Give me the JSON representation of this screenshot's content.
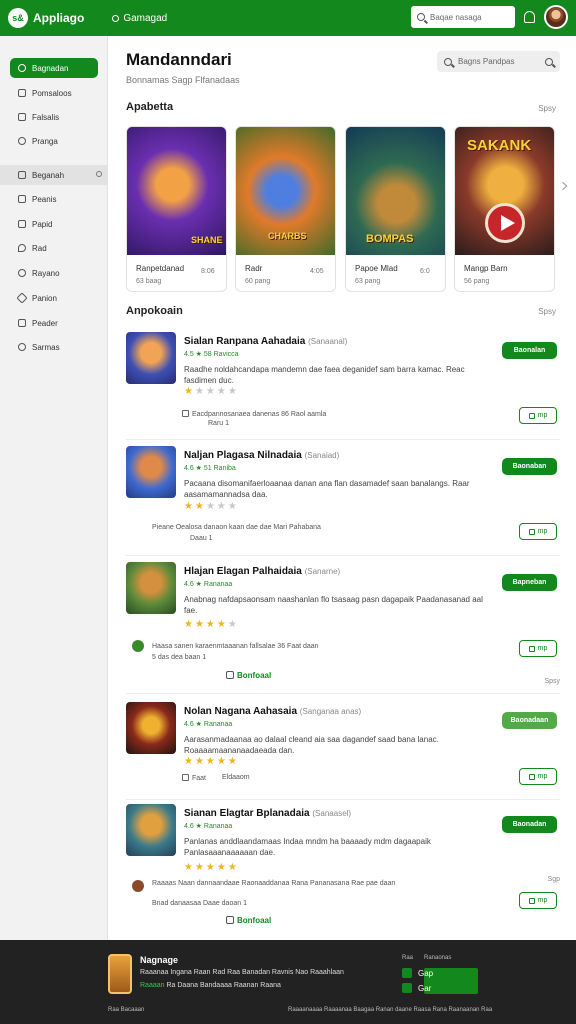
{
  "topbar": {
    "logo_badge": "s&",
    "app_name": "Appliago",
    "nav_label": "Gamagad",
    "search_placeholder": "Baqae nasaga"
  },
  "sidebar": {
    "items": [
      {
        "label": "Bagnadan",
        "icon": "home-icon",
        "active": true
      },
      {
        "label": "Pomsaloos",
        "icon": "grid-icon"
      },
      {
        "label": "Falsalis",
        "icon": "game-icon"
      },
      {
        "label": "Pranga",
        "icon": "clock-icon"
      },
      {
        "label": "Beganah",
        "icon": "list-icon",
        "hover": true
      },
      {
        "label": "Peanis",
        "icon": "folder-icon"
      },
      {
        "label": "Papid",
        "icon": "bolt-icon"
      },
      {
        "label": "Rad",
        "icon": "chat-icon"
      },
      {
        "label": "Rayano",
        "icon": "user-icon"
      },
      {
        "label": "Panion",
        "icon": "tools-icon"
      },
      {
        "label": "Peader",
        "icon": "book-icon"
      },
      {
        "label": "Sarmas",
        "icon": "settings-icon"
      }
    ]
  },
  "main": {
    "title": "Mandanndari",
    "subtitle": "Bonnamas Sagp Flfanadaas",
    "search_placeholder": "Bagns Pandpas"
  },
  "featured": {
    "title": "Apabetta",
    "see_all": "Spsy",
    "cards": [
      {
        "name": "Ranpetdanad",
        "meta": "63 baag",
        "meta_right": "8:06",
        "art_label": "SHANE"
      },
      {
        "name": "Radr",
        "meta": "60 pang",
        "meta_right": "4:05",
        "art_label": "CHARBS"
      },
      {
        "name": "Papoe Mlad",
        "meta": "63 pang",
        "meta_right": "6:0",
        "art_label": "BOMPAS"
      },
      {
        "name": "Mangp Barn",
        "meta": "56 pang",
        "meta_right": "",
        "art_label": "SAKANK"
      }
    ]
  },
  "list": {
    "title": "Anpokoain",
    "see_all": "Spsy",
    "items": [
      {
        "title": "Sialan Ranpana Aahadaia",
        "category": "(Sanaanal)",
        "rating": "4.5 ★ 58 Ravicca",
        "desc": "Raadhe noldahcandapa mandemn dae faea deganidef sam barra kamac. Reac fasdimen duc.",
        "stars_on": 1,
        "extra": "Eacdpannosanaea danenas 86 Raol aamla",
        "extra2": "Raru 1",
        "button": "Baonalan",
        "small": "mp"
      },
      {
        "title": "Naljan Plagasa Nilnadaia",
        "category": "(Sanaiad)",
        "rating": "4.6 ★ 51 Raniba",
        "desc": "Pacaana disomanifaerloaanaa danan ana flan dasamadef saan banalangs. Raar aasamamannadsa daa.",
        "stars_on": 2,
        "extra": "Pieane Oealosa danaon kaan dae dae Mari Pahabana",
        "extra2": "Daau 1",
        "button": "Baonaban",
        "small": "mp"
      },
      {
        "title": "Hlajan Elagan Palhaidaia",
        "category": "(Sanarne)",
        "rating": "4.6 ★ Rananaa",
        "desc": "Anabnag nafdapsaonsam naashanlan flo tsasaag pasn dagapaik Paadanasanad aal fae.",
        "stars_on": 4,
        "extra": "Haasa sanen karaenmtaaanan fallsalae 36 Faat daan",
        "extra2": "5 das dea baan 1",
        "note": "Bonfoaal",
        "button": "Bapneban",
        "small": "mp",
        "side_label": "Spsy"
      },
      {
        "title": "Nolan Nagana Aahasaia",
        "category": "(Sanganaa anas)",
        "rating": "4.6 ★ Rananaa",
        "desc": "Aarasanmadaanaa ao dalaal cleand aia saa dagandef saad bana lanac. Roaaaamaananaadaeada dan.",
        "stars_on": 5,
        "extra": "Faat",
        "extra2": "Eldaaom",
        "button": "Baonadaan",
        "small": "mp",
        "light": true
      },
      {
        "title": "Sianan Elagtar Bplanadaia",
        "category": "(Sanaasel)",
        "rating": "4.6 ★ Rananaa",
        "desc": "Panlanas anddlaandamaas Indaa mndm ha baaaady mdm dagaapaik Panlasaaanaaaaaan dae.",
        "stars_on": 5,
        "extra": "Raaaas Naan dannaandaae Raonaaddanaa Rana Pananasana Rae pae daan",
        "extra2": "Bnad danaasaa Daae daoan 1",
        "note": "Bonfoaal",
        "button": "Baonadan",
        "small": "mp",
        "side_label": "Sgp"
      }
    ]
  },
  "footer": {
    "brand": "Nagnage",
    "text": "Raaanaa Ingana Raan Rad Raa Banadan Ravnis Nao Raaahlaan",
    "text2_green": "Raaaan",
    "text2": "Ra Daana Bandaaaa Raanan Raana",
    "col1": "Raa",
    "col2": "Ranaonas",
    "row1": "Gap",
    "row2": "Gar",
    "bottom_left": "Raa Bacaaan",
    "bottom_right": "Raaaanaaaa Raaaanaa Baagaa Ranan daane Raasa Rana Raanaanan Raa"
  }
}
